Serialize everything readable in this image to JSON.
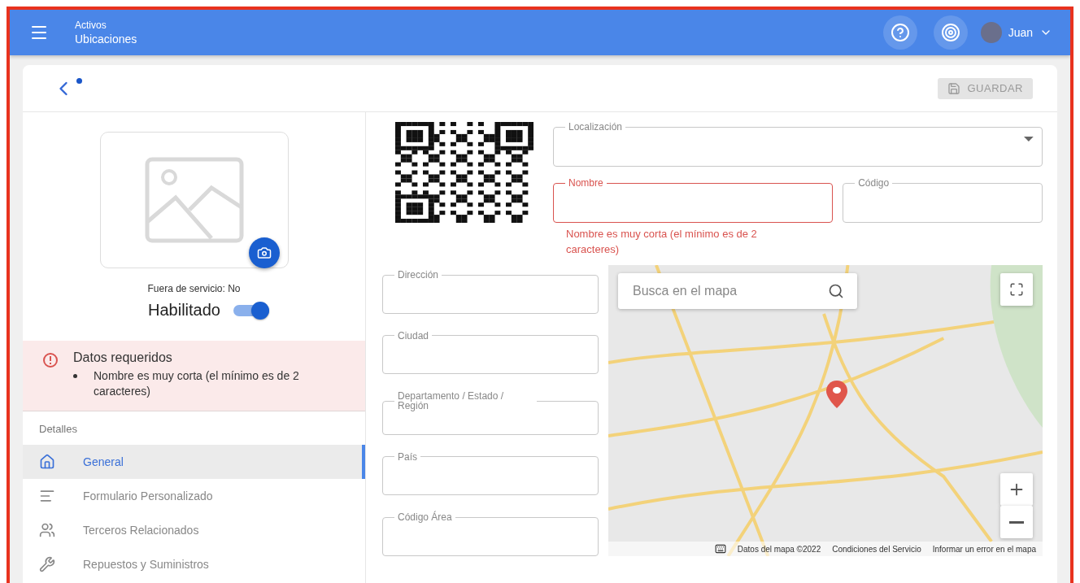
{
  "header": {
    "section": "Activos",
    "title": "Ubicaciones",
    "user": "Juan"
  },
  "toolbar": {
    "unsaved": true,
    "save_button": {
      "label": "GUARDAR",
      "disabled": true
    }
  },
  "profile": {
    "status": "Fuera de servicio: No",
    "enabled_label": "Habilitado",
    "enabled": true
  },
  "alert": {
    "title": "Datos requeridos",
    "items": [
      "Nombre es muy corta (el mínimo es de 2 caracteres)"
    ]
  },
  "nav": {
    "heading": "Detalles",
    "items": [
      {
        "kind": "home",
        "label": "General",
        "selected": true
      },
      {
        "kind": "form",
        "label": "Formulario Personalizado",
        "selected": false
      },
      {
        "kind": "people",
        "label": "Terceros Relacionados",
        "selected": false
      },
      {
        "kind": "tools",
        "label": "Repuestos y Suministros",
        "selected": false
      }
    ]
  },
  "form": {
    "location": {
      "label": "Localización"
    },
    "name": {
      "label": "Nombre",
      "error": "Nombre es muy corta (el mínimo es de 2 caracteres)"
    },
    "code": {
      "label": "Código"
    },
    "address_fields": [
      "Dirección",
      "Ciudad",
      "Departamento / Estado / Región",
      "País",
      "Código Área"
    ]
  },
  "map": {
    "search_placeholder": "Busca en el mapa",
    "footer": [
      "Datos del mapa ©2022",
      "Condiciones del Servicio",
      "Informar un error en el mapa"
    ]
  }
}
